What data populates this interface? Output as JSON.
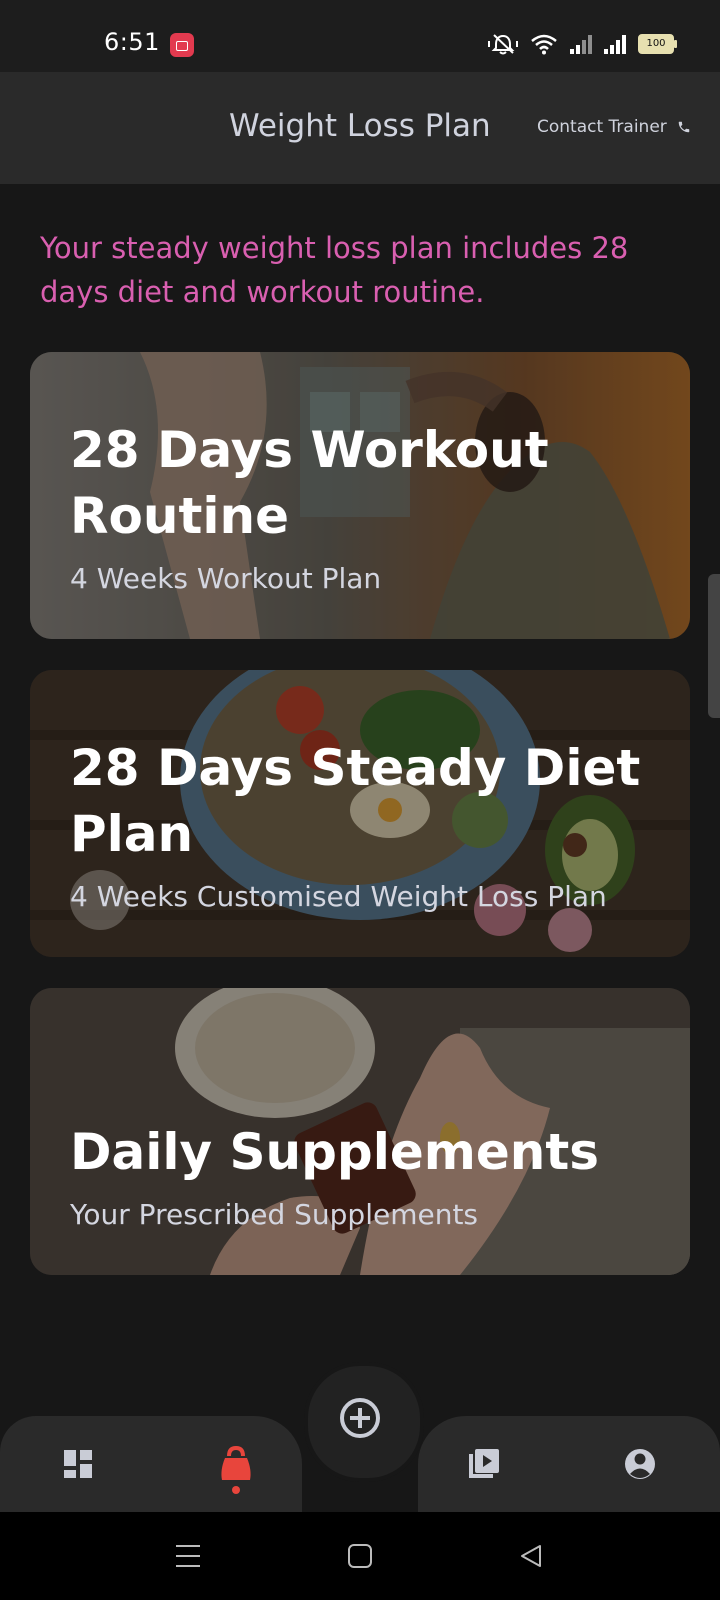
{
  "status_bar": {
    "time": "6:51",
    "battery": "100",
    "icons": [
      "screen-record-icon",
      "mute-icon",
      "wifi-icon",
      "signal-icon",
      "signal-icon",
      "battery-icon"
    ]
  },
  "header": {
    "title": "Weight Loss Plan",
    "contact_label": "Contact Trainer",
    "contact_icon": "phone-icon"
  },
  "intro": "Your steady weight loss plan includes 28 days diet and workout routine.",
  "cards": [
    {
      "title": "28 Days Workout Routine",
      "title_l1": "28 Days Workout",
      "title_l2": "Routine",
      "subtitle": "4 Weeks Workout Plan"
    },
    {
      "title": "28 Days Steady Diet Plan",
      "title_l1": "28 Days Steady Diet",
      "title_l2": "Plan",
      "subtitle": "4 Weeks Customised Weight Loss Plan"
    },
    {
      "title": "Daily Supplements",
      "title_l1": "Daily Supplements",
      "title_l2": "",
      "subtitle": "Your Prescribed Supplements"
    }
  ],
  "bottom_nav": {
    "items": [
      "dashboard-icon",
      "kettlebell-icon",
      "add-circle-icon",
      "video-library-icon",
      "account-icon"
    ],
    "active": "kettlebell-icon",
    "active_color": "#e8453c"
  },
  "colors": {
    "accent_pink": "#d95fb0",
    "background": "#171717",
    "bar": "#2a2a2a"
  }
}
